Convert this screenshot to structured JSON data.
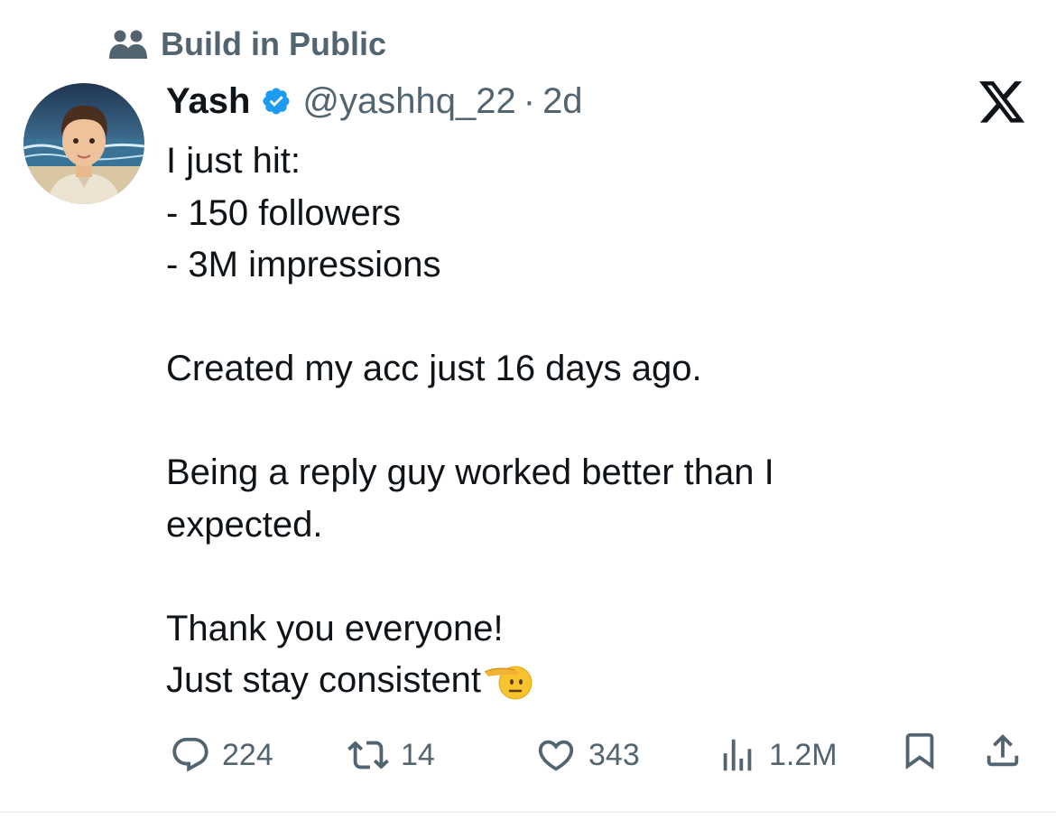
{
  "community": {
    "label": "Build in Public",
    "icon": "community-icon"
  },
  "author": {
    "name": "Yash",
    "verified": true,
    "handle": "@yashhq_22",
    "separator": "·",
    "time": "2d"
  },
  "brand": {
    "icon": "x-logo-icon"
  },
  "tweet": {
    "lines": [
      "I just hit:",
      "- 150 followers",
      "- 3M impressions",
      "",
      "Created my acc just 16 days ago.",
      "",
      "Being a reply guy worked better than I",
      "expected.",
      "",
      "Thank you everyone!",
      "Just stay consistent"
    ],
    "emoji": "saluting-face-emoji"
  },
  "actions": {
    "replies": "224",
    "reposts": "14",
    "likes": "343",
    "views": "1.2M"
  },
  "colors": {
    "text": "#0f1419",
    "secondary": "#536471",
    "verified": "#1d9bf0"
  }
}
